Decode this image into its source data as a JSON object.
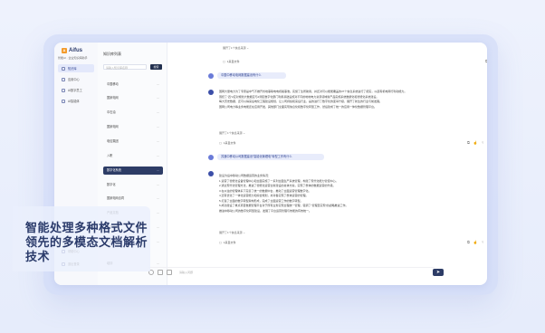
{
  "app": {
    "logo_mark": "A",
    "logo": "Aifus",
    "brand_sub": "智能AI · 企业知识库助手"
  },
  "nav": [
    {
      "label": "知识库",
      "active": true
    },
    {
      "label": "应用中心"
    },
    {
      "label": "AI数字员工"
    },
    {
      "label": "AI智能体"
    }
  ],
  "nav_bottom": [
    {
      "label": "帮助中心"
    },
    {
      "label": "退出登录"
    }
  ],
  "kb": {
    "title": "知识库列表",
    "search_placeholder": "请输入知识库名称",
    "search_button": "搜索",
    "items": [
      {
        "label": "中国移动"
      },
      {
        "label": "国家电网"
      },
      {
        "label": "中石油"
      },
      {
        "label": "国家电网"
      },
      {
        "label": "电信集团"
      },
      {
        "label": "入职"
      },
      {
        "label": "数字化系统",
        "active": true
      },
      {
        "label": "数字化"
      },
      {
        "label": "国家电网合同"
      },
      {
        "label": "产品文档"
      },
      {
        "label": "财务管理"
      },
      {
        "label": "人事"
      },
      {
        "label": "培训"
      }
    ]
  },
  "chat": {
    "expand_label": "展开了1个信息来源",
    "source_label": "1来自文件",
    "question1": "中国中移动电网数据建设有什么",
    "answer1": [
      "国网大量电力为了专家是中气不推开省地事联电电视着事准。实施了生所助用，并还对可以能能覆盖的37个信息系统进行了把实，以起有机电网行利动能力。",
      "围绕了“四”2应对规划大数据应与2测区数字化部门利用基础设施对不同的地地电力资源领域新产品实施系统数据化和智能化系统建设。",
      "每大历史数据，还可以得来后电化工程建设规划，让公司持续和来后行业，是的进行了数字化的变革升级，展开了新生的行业与前发展。",
      "国网公司电力等业务电能还在应用开发，其他部门全面实现信息化和数字化转型工作，然后建成了统一的应用一体化数据管理平台。"
    ],
    "question2": "苏通中移动公司数据建设“智能化管理电”转型工作有什么",
    "answer2": [
      "建设为后中移动公司数据运营的业务情况：",
      "1.运营了智能化设备管理中心和全面实施了一系列全面生产系统管理，构建了现代化能力管控中心。",
      "2.通过现代化管理方法，推进了智能化运营全新建设的总体方案，实现了整体的数据运营的升级。",
      "3.在以往的管理体系下完善了统一的数据中台，推动了全面运营管理数字化。",
      "4.还有优化了一体化运营能力和综合规划，并对各实现了整体运营的管理。",
      "5.打造了全面的数字转型架构形成，完成了全面运营工作的数字转型。",
      "6.成功建设了重点项目数据管理平台对于所有业务实现全程统一管理，强调了“管理至实现”的战略推进工作。",
      "推进中移动公司的数字化转型建设，发展了平台运营管理与效能的有效统一。"
    ],
    "input_placeholder": "请输入问题",
    "send_icon": "send-icon"
  },
  "caption": [
    "智能处理多种格式文件",
    "领先的多模态文档解析",
    "技术"
  ]
}
